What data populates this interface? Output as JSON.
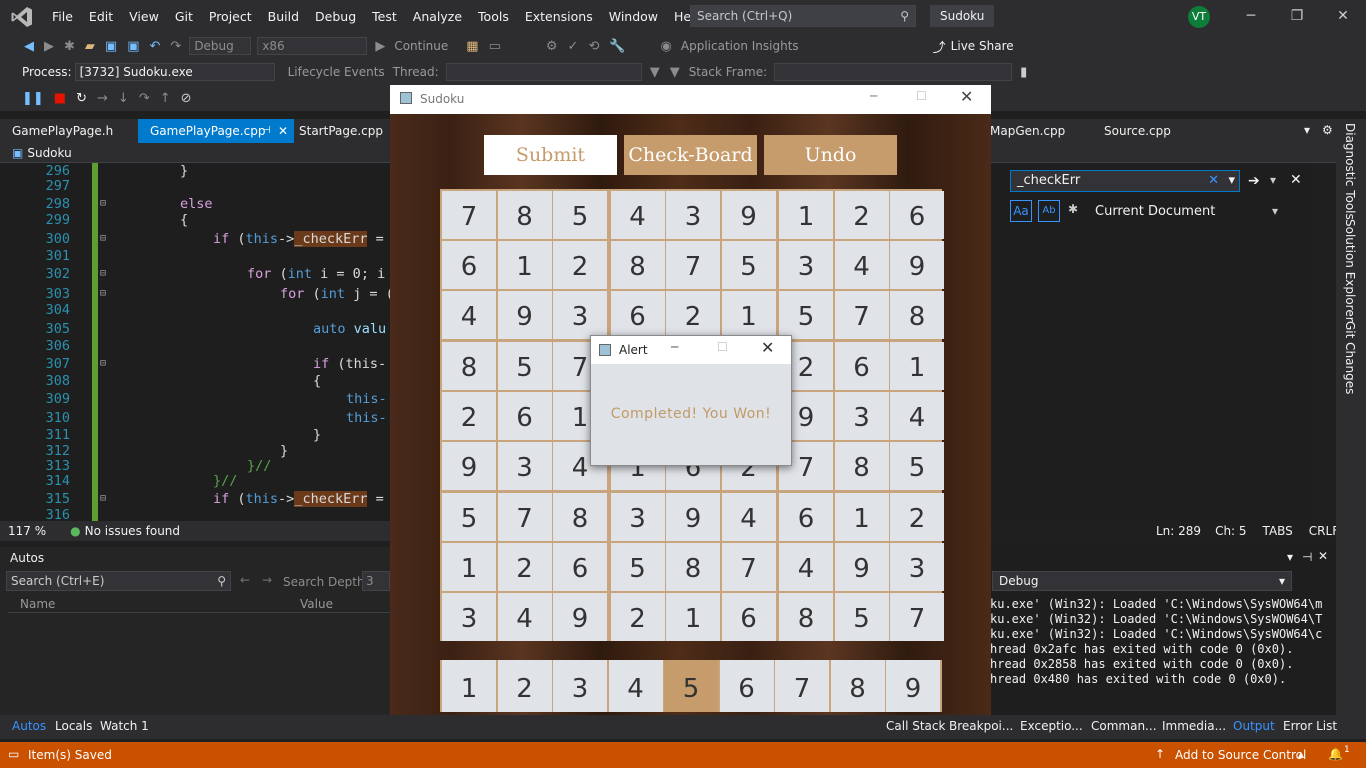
{
  "menu": {
    "items": [
      "File",
      "Edit",
      "View",
      "Git",
      "Project",
      "Build",
      "Debug",
      "Test",
      "Analyze",
      "Tools",
      "Extensions",
      "Window",
      "Help"
    ],
    "search_placeholder": "Search (Ctrl+Q)",
    "solution": "Sudoku",
    "avatar": "VT"
  },
  "toolbar": {
    "config": "Debug",
    "platform": "x86",
    "continue": "Continue",
    "app_insights": "Application Insights",
    "live_share": "Live Share",
    "process_label": "Process:",
    "process": "[3732] Sudoku.exe",
    "lifecycle": "Lifecycle Events",
    "thread_label": "Thread:",
    "stack_label": "Stack Frame:"
  },
  "tabs": {
    "t1": "GamePlayPage.h",
    "t2": "GamePlayPage.cpp",
    "t3": "StartPage.cpp",
    "t4": "MapGen.cpp",
    "t5": "Source.cpp"
  },
  "navbar": {
    "project": "Sudoku"
  },
  "code": {
    "l296": "296",
    "l297": "297",
    "l298": "298",
    "l299": "299",
    "l300": "300",
    "l301": "301",
    "l302": "302",
    "l303": "303",
    "l304": "304",
    "l305": "305",
    "l306": "306",
    "l307": "307",
    "l308": "308",
    "l309": "309",
    "l310": "310",
    "l311": "311",
    "l312": "312",
    "l313": "313",
    "l314": "314",
    "l315": "315",
    "l316": "316",
    "c296": "}",
    "c298": "else",
    "c299": "{",
    "c300a": "if",
    "c300b": " (",
    "c300c": "this",
    "c300d": "->",
    "c300e": "_checkErr",
    "c300f": " =",
    "c302a": "for",
    "c302b": " (",
    "c302c": "int",
    "c302d": " i = 0; i",
    "c303a": "for",
    "c303b": " (",
    "c303c": "int",
    "c303d": " j = (",
    "c305a": "auto",
    "c305b": " valu",
    "c307a": "if",
    "c307b": " (this-",
    "c308": "{",
    "c309": "this-",
    "c310": "this-",
    "c311": "}",
    "c312": "}",
    "c313": "}//",
    "c314": "}//",
    "c315a": "if",
    "c315b": " (",
    "c315c": "this",
    "c315d": "->",
    "c315e": "_checkErr",
    "c315f": " ="
  },
  "editor_status": {
    "zoom": "117 %",
    "issues": "No issues found",
    "ln": "Ln: 289",
    "ch": "Ch: 5",
    "tabs": "TABS",
    "crlf": "CRLF"
  },
  "find": {
    "query": "_checkErr",
    "scope": "Current Document"
  },
  "autos": {
    "title": "Autos",
    "search": "Search (Ctrl+E)",
    "depth_label": "Search Depth:",
    "depth": "3",
    "col_name": "Name",
    "col_value": "Value"
  },
  "output": {
    "source": "Debug",
    "lines": [
      "ku.exe' (Win32): Loaded 'C:\\Windows\\SysWOW64\\m",
      "ku.exe' (Win32): Loaded 'C:\\Windows\\SysWOW64\\T",
      "ku.exe' (Win32): Loaded 'C:\\Windows\\SysWOW64\\c",
      "hread 0x2afc has exited with code 0 (0x0).",
      "hread 0x2858 has exited with code 0 (0x0).",
      "hread 0x480 has exited with code 0 (0x0)."
    ]
  },
  "bottom_tabs": {
    "autos": "Autos",
    "locals": "Locals",
    "watch": "Watch 1",
    "callstack": "Call Stack",
    "breakpoints": "Breakpoi...",
    "exceptions": "Exceptio...",
    "command": "Comman...",
    "immediate": "Immedia...",
    "output": "Output",
    "errorlist": "Error List"
  },
  "status": {
    "saved": "Item(s) Saved",
    "source_control": "Add to Source Control",
    "notifications": "1"
  },
  "side_tabs": {
    "diag": "Diagnostic Tools",
    "sol": "Solution Explorer",
    "git": "Git Changes"
  },
  "sudoku": {
    "title": "Sudoku",
    "submit": "Submit",
    "check": "Check-Board",
    "undo": "Undo",
    "board": [
      [
        "7",
        "8",
        "5",
        "4",
        "3",
        "9",
        "1",
        "2",
        "6"
      ],
      [
        "6",
        "1",
        "2",
        "8",
        "7",
        "5",
        "3",
        "4",
        "9"
      ],
      [
        "4",
        "9",
        "3",
        "6",
        "2",
        "1",
        "5",
        "7",
        "8"
      ],
      [
        "8",
        "5",
        "7",
        "",
        "",
        "",
        "2",
        "6",
        "1"
      ],
      [
        "2",
        "6",
        "1",
        "",
        "",
        "",
        "9",
        "3",
        "4"
      ],
      [
        "9",
        "3",
        "4",
        "1",
        "6",
        "2",
        "7",
        "8",
        "5"
      ],
      [
        "5",
        "7",
        "8",
        "3",
        "9",
        "4",
        "6",
        "1",
        "2"
      ],
      [
        "1",
        "2",
        "6",
        "5",
        "8",
        "7",
        "4",
        "9",
        "3"
      ],
      [
        "3",
        "4",
        "9",
        "2",
        "1",
        "6",
        "8",
        "5",
        "7"
      ]
    ],
    "picker": [
      "1",
      "2",
      "3",
      "4",
      "5",
      "6",
      "7",
      "8",
      "9"
    ],
    "picker_selected": 4
  },
  "alert": {
    "title": "Alert",
    "message": "Completed! You Won!"
  }
}
